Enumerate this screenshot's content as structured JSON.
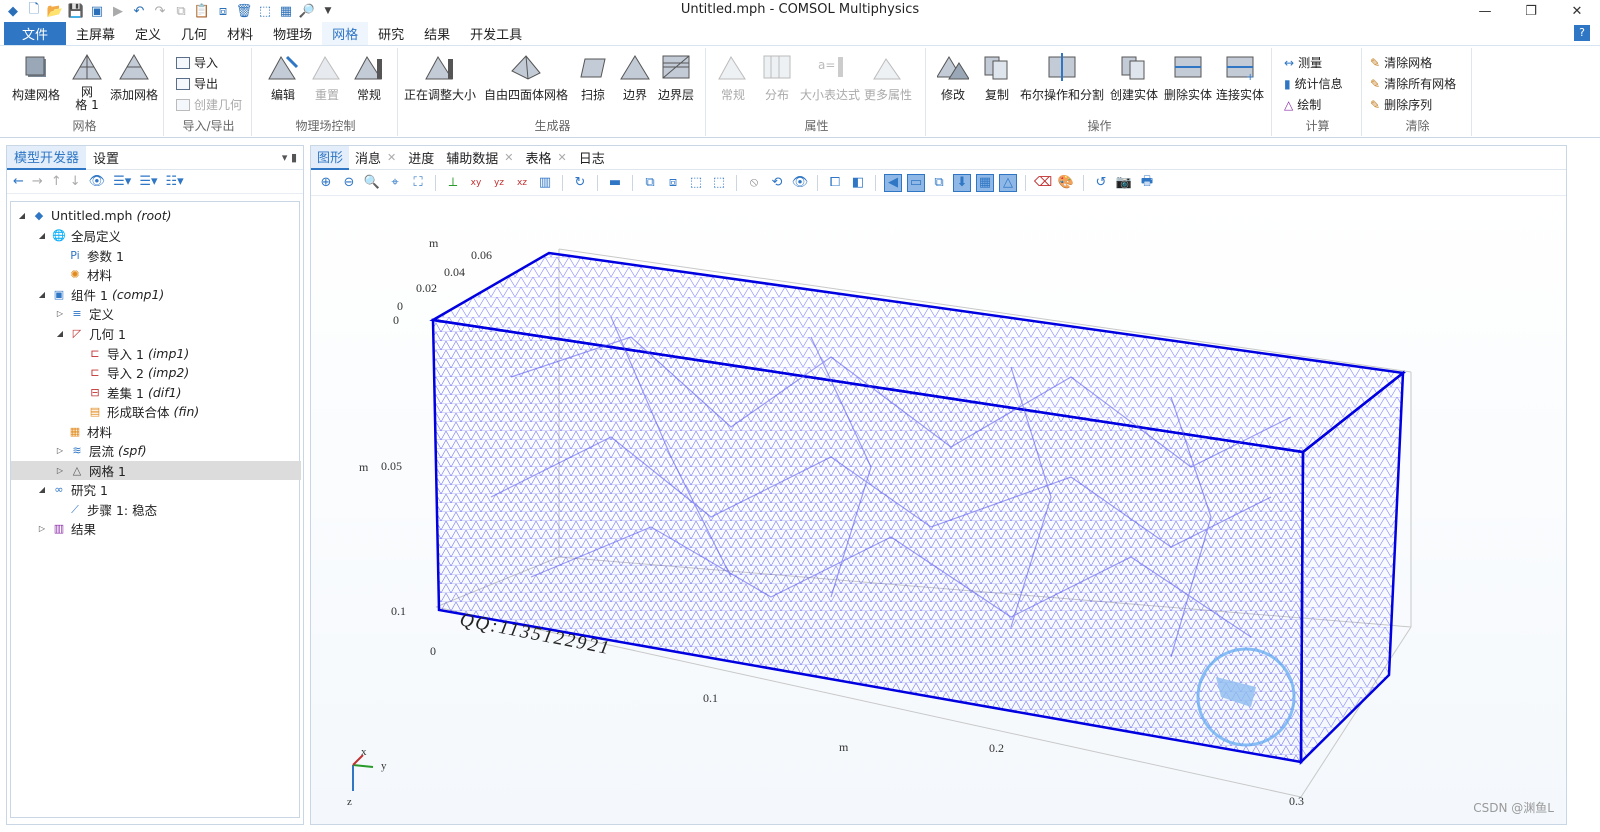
{
  "window": {
    "title": "Untitled.mph - COMSOL Multiphysics",
    "controls": [
      "—",
      "❐",
      "✕"
    ]
  },
  "menu": {
    "items": [
      "文件",
      "主屏幕",
      "定义",
      "几何",
      "材料",
      "物理场",
      "网格",
      "研究",
      "结果",
      "开发工具"
    ],
    "active": "网格",
    "help": "?"
  },
  "ribbon": {
    "groups": {
      "mesh": "网格",
      "import_export": "导入/导出",
      "physics_control": "物理场控制",
      "generators": "生成器",
      "properties": "属性",
      "operations": "操作",
      "compute": "计算",
      "clear": "清除"
    },
    "buttons": {
      "build_mesh": "构建网格",
      "mesh1": "网\n格 1",
      "add_mesh": "添加网格",
      "import": "导入",
      "export": "导出",
      "create_geometry": "创建几何",
      "edit": "编辑",
      "reset": "重置",
      "normal": "常规",
      "resizing": "正在调整大小",
      "free_tet": "自由四面体网格",
      "sweep": "扫掠",
      "boundary": "边界",
      "boundary_layer": "边界层",
      "prop_normal": "常规",
      "distribution": "分布",
      "size_expr": "大小表达式",
      "more_props": "更多属性",
      "modify": "修改",
      "copy": "复制",
      "boolean": "布尔操作和分割",
      "create_entity": "创建实体",
      "delete_entity": "删除实体",
      "connect_entity": "连接实体",
      "measure": "测量",
      "statistics": "统计信息",
      "plot": "绘制",
      "clear_mesh": "清除网格",
      "clear_all_mesh": "清除所有网格",
      "delete_sequence": "删除序列"
    }
  },
  "left_panel": {
    "tabs": [
      "模型开发器",
      "设置"
    ],
    "tree": [
      {
        "label": "Untitled.mph",
        "suffix": "(root)"
      },
      {
        "label": "全局定义",
        "suffix": ""
      },
      {
        "label": "参数 1",
        "suffix": ""
      },
      {
        "label": "材料",
        "suffix": ""
      },
      {
        "label": "组件 1",
        "suffix": "(comp1)"
      },
      {
        "label": "定义",
        "suffix": ""
      },
      {
        "label": "几何 1",
        "suffix": ""
      },
      {
        "label": "导入 1",
        "suffix": "(imp1)"
      },
      {
        "label": "导入 2",
        "suffix": "(imp2)"
      },
      {
        "label": "差集 1",
        "suffix": "(dif1)"
      },
      {
        "label": "形成联合体",
        "suffix": "(fin)"
      },
      {
        "label": "材料",
        "suffix": ""
      },
      {
        "label": "层流",
        "suffix": "(spf)"
      },
      {
        "label": "网格 1",
        "suffix": ""
      },
      {
        "label": "研究 1",
        "suffix": ""
      },
      {
        "label": "步骤 1: 稳态",
        "suffix": ""
      },
      {
        "label": "结果",
        "suffix": ""
      }
    ]
  },
  "graphics_panel": {
    "tabs": [
      "图形",
      "消息",
      "进度",
      "辅助数据",
      "表格",
      "日志"
    ],
    "axis_labels": {
      "y_top": [
        "0.06",
        "0.04",
        "0.02",
        "0"
      ],
      "y_unit": "m",
      "z_left": [
        "0",
        "0.05",
        "0.1"
      ],
      "z_unit": "m",
      "x_bottom": [
        "0",
        "0.1",
        "0.2",
        "0.3"
      ],
      "x_unit": "m"
    },
    "triad": {
      "x": "x",
      "y": "y",
      "z": "z"
    },
    "overlay_text": "QQ:1135122921",
    "watermark": "CSDN @渊鱼L"
  },
  "colors": {
    "accent": "#2f76c5",
    "mesh": "#3b3bf0",
    "mesh_edge": "#0000e0"
  }
}
